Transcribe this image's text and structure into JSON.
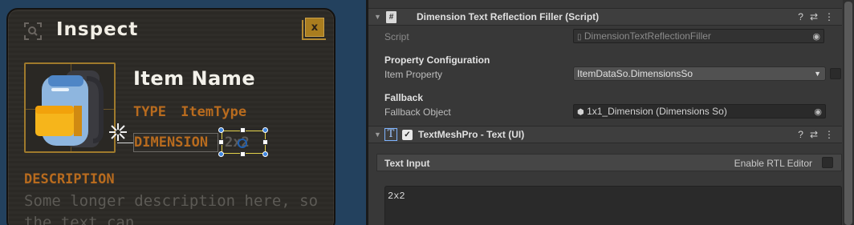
{
  "scene": {
    "panel_title": "Inspect",
    "close_label": "x",
    "item_name": "Item Name",
    "type_label": "TYPE",
    "type_value": "ItemType",
    "dimension_label": "DIMENSION",
    "dimension_value": "2x2",
    "description_label": "DESCRIPTION",
    "description_text": "Some longer description here, so the text can"
  },
  "inspector": {
    "component1": {
      "title": "Dimension Text Reflection Filler (Script)",
      "script_label": "Script",
      "script_value": "DimensionTextReflectionFiller",
      "section_property": "Property Configuration",
      "item_property_label": "Item Property",
      "item_property_value": "ItemDataSo.DimensionsSo",
      "section_fallback": "Fallback",
      "fallback_label": "Fallback Object",
      "fallback_value": "1x1_Dimension (Dimensions So)"
    },
    "component2": {
      "title": "TextMeshPro - Text (UI)",
      "text_input_label": "Text Input",
      "enable_rtl_label": "Enable RTL Editor",
      "text_value": "2x2"
    }
  },
  "colors": {
    "scene_bg": "#23415e",
    "accent_orange": "#b86b1e",
    "frame_gold": "#9f7a2c",
    "inspector_bg": "#383838"
  }
}
